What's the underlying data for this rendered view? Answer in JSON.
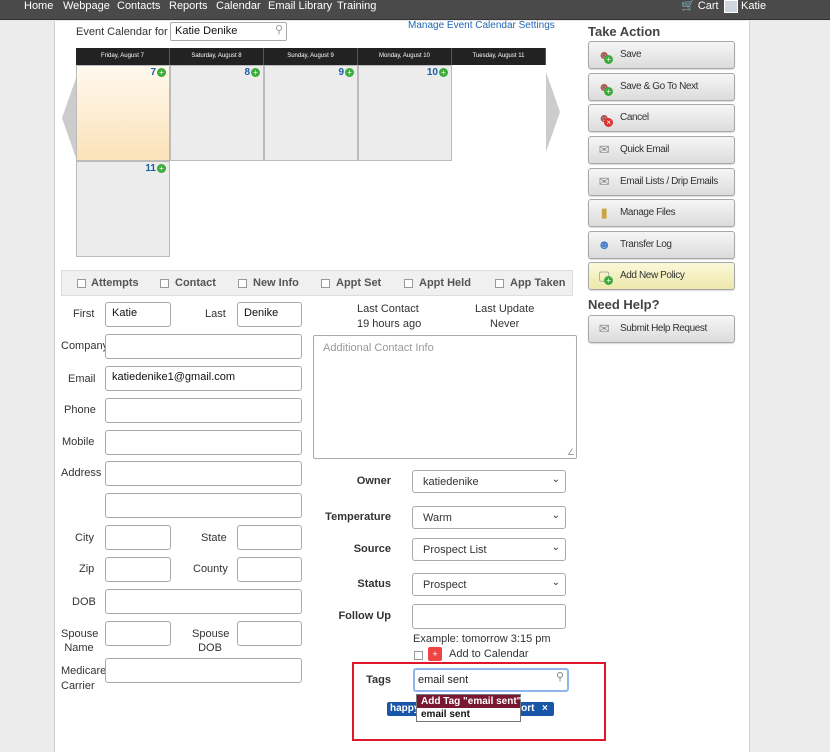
{
  "nav": {
    "items": [
      "Home",
      "Webpage",
      "Contacts",
      "Reports",
      "Calendar",
      "Email Library",
      "Training"
    ],
    "cart": "Cart",
    "user": "Katie"
  },
  "calendar": {
    "label": "Event Calendar for",
    "selected_person": "Katie Denike",
    "manage_link": "Manage Event Calendar Settings",
    "days": [
      {
        "header": "Friday, August 7",
        "num": "7"
      },
      {
        "header": "Saturday, August 8",
        "num": "8"
      },
      {
        "header": "Sunday, August 9",
        "num": "9"
      },
      {
        "header": "Monday, August 10",
        "num": "10"
      },
      {
        "header": "Tuesday, August 11",
        "num": "11"
      }
    ]
  },
  "checkboxes": [
    "Attempts",
    "Contact",
    "New Info",
    "Appt Set",
    "Appt Held",
    "App Taken"
  ],
  "form": {
    "first_label": "First",
    "first_value": "Katie",
    "last_label": "Last",
    "last_value": "Denike",
    "company_label": "Company",
    "email_label": "Email",
    "email_value": "katiedenike1@gmail.com",
    "phone_label": "Phone",
    "mobile_label": "Mobile",
    "address_label": "Address",
    "city_label": "City",
    "state_label": "State",
    "zip_label": "Zip",
    "county_label": "County",
    "dob_label": "DOB",
    "spouse_name_label": [
      "Spouse",
      "Name"
    ],
    "spouse_dob_label": [
      "Spouse",
      "DOB"
    ],
    "medicare_label": [
      "Medicare",
      "Carrier"
    ]
  },
  "info": {
    "last_contact_label": "Last Contact",
    "last_contact_value": "19 hours ago",
    "last_update_label": "Last Update",
    "last_update_value": "Never",
    "additional_placeholder": "Additional Contact Info"
  },
  "fields": {
    "owner_label": "Owner",
    "owner_value": "katiedenike",
    "temperature_label": "Temperature",
    "temperature_value": "Warm",
    "source_label": "Source",
    "source_value": "Prospect List",
    "status_label": "Status",
    "status_value": "Prospect",
    "followup_label": "Follow Up",
    "example": "Example: tomorrow 3:15 pm",
    "add_calendar": "Add to Calendar",
    "tags_label": "Tags",
    "tags_input": "email sent",
    "tag_chip_left": "happy",
    "tag_chip_right": "port",
    "dropdown_add": "Add Tag \"email sent\"",
    "dropdown_option": "email sent"
  },
  "actions": {
    "title": "Take Action",
    "buttons": [
      "Save",
      "Save & Go To Next",
      "Cancel",
      "Quick Email",
      "Email Lists / Drip Emails",
      "Manage Files",
      "Transfer Log",
      "Add New Policy"
    ],
    "help_title": "Need Help?",
    "help_button": "Submit Help Request"
  },
  "colors": {
    "highlight_box": "#e0162b",
    "dropdown_active": "#7a1733",
    "tag_chip": "#1a56a8"
  }
}
